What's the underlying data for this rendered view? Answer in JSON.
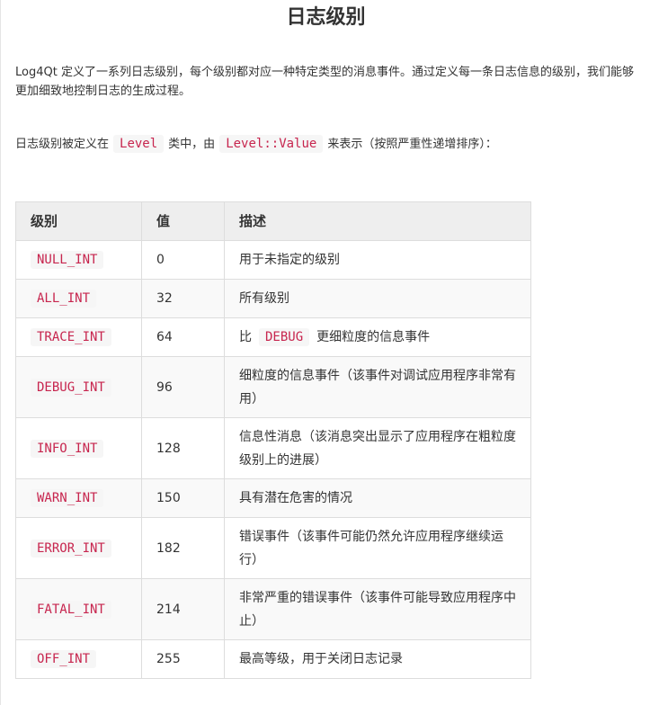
{
  "title": "日志级别",
  "intro": "Log4Qt 定义了一系列日志级别，每个级别都对应一种特定类型的消息事件。通过定义每一条日志信息的级别，我们能够更加细致地控制日志的生成过程。",
  "definition": {
    "prefix": "日志级别被定义在",
    "class_code": "Level",
    "middle": "类中，由",
    "enum_code": "Level::Value",
    "suffix": "来表示（按照严重性递增排序）："
  },
  "table": {
    "headers": [
      "级别",
      "值",
      "描述"
    ],
    "rows": [
      {
        "level": "NULL_INT",
        "value": "0",
        "desc": "用于未指定的级别"
      },
      {
        "level": "ALL_INT",
        "value": "32",
        "desc": "所有级别"
      },
      {
        "level": "TRACE_INT",
        "value": "64",
        "desc_prefix": "比",
        "desc_code": "DEBUG",
        "desc_suffix": "更细粒度的信息事件"
      },
      {
        "level": "DEBUG_INT",
        "value": "96",
        "desc": "细粒度的信息事件（该事件对调试应用程序非常有用）"
      },
      {
        "level": "INFO_INT",
        "value": "128",
        "desc": "信息性消息（该消息突出显示了应用程序在粗粒度级别上的进展）"
      },
      {
        "level": "WARN_INT",
        "value": "150",
        "desc": "具有潜在危害的情况"
      },
      {
        "level": "ERROR_INT",
        "value": "182",
        "desc": "错误事件（该事件可能仍然允许应用程序继续运行）"
      },
      {
        "level": "FATAL_INT",
        "value": "214",
        "desc": "非常严重的错误事件（该事件可能导致应用程序中止）"
      },
      {
        "level": "OFF_INT",
        "value": "255",
        "desc": "最高等级，用于关闭日志记录"
      }
    ]
  },
  "colors": {
    "code_text": "#c7254e",
    "code_bg": "#f6f6f6",
    "header_bg": "#eeeeee",
    "border": "#dddddd"
  }
}
